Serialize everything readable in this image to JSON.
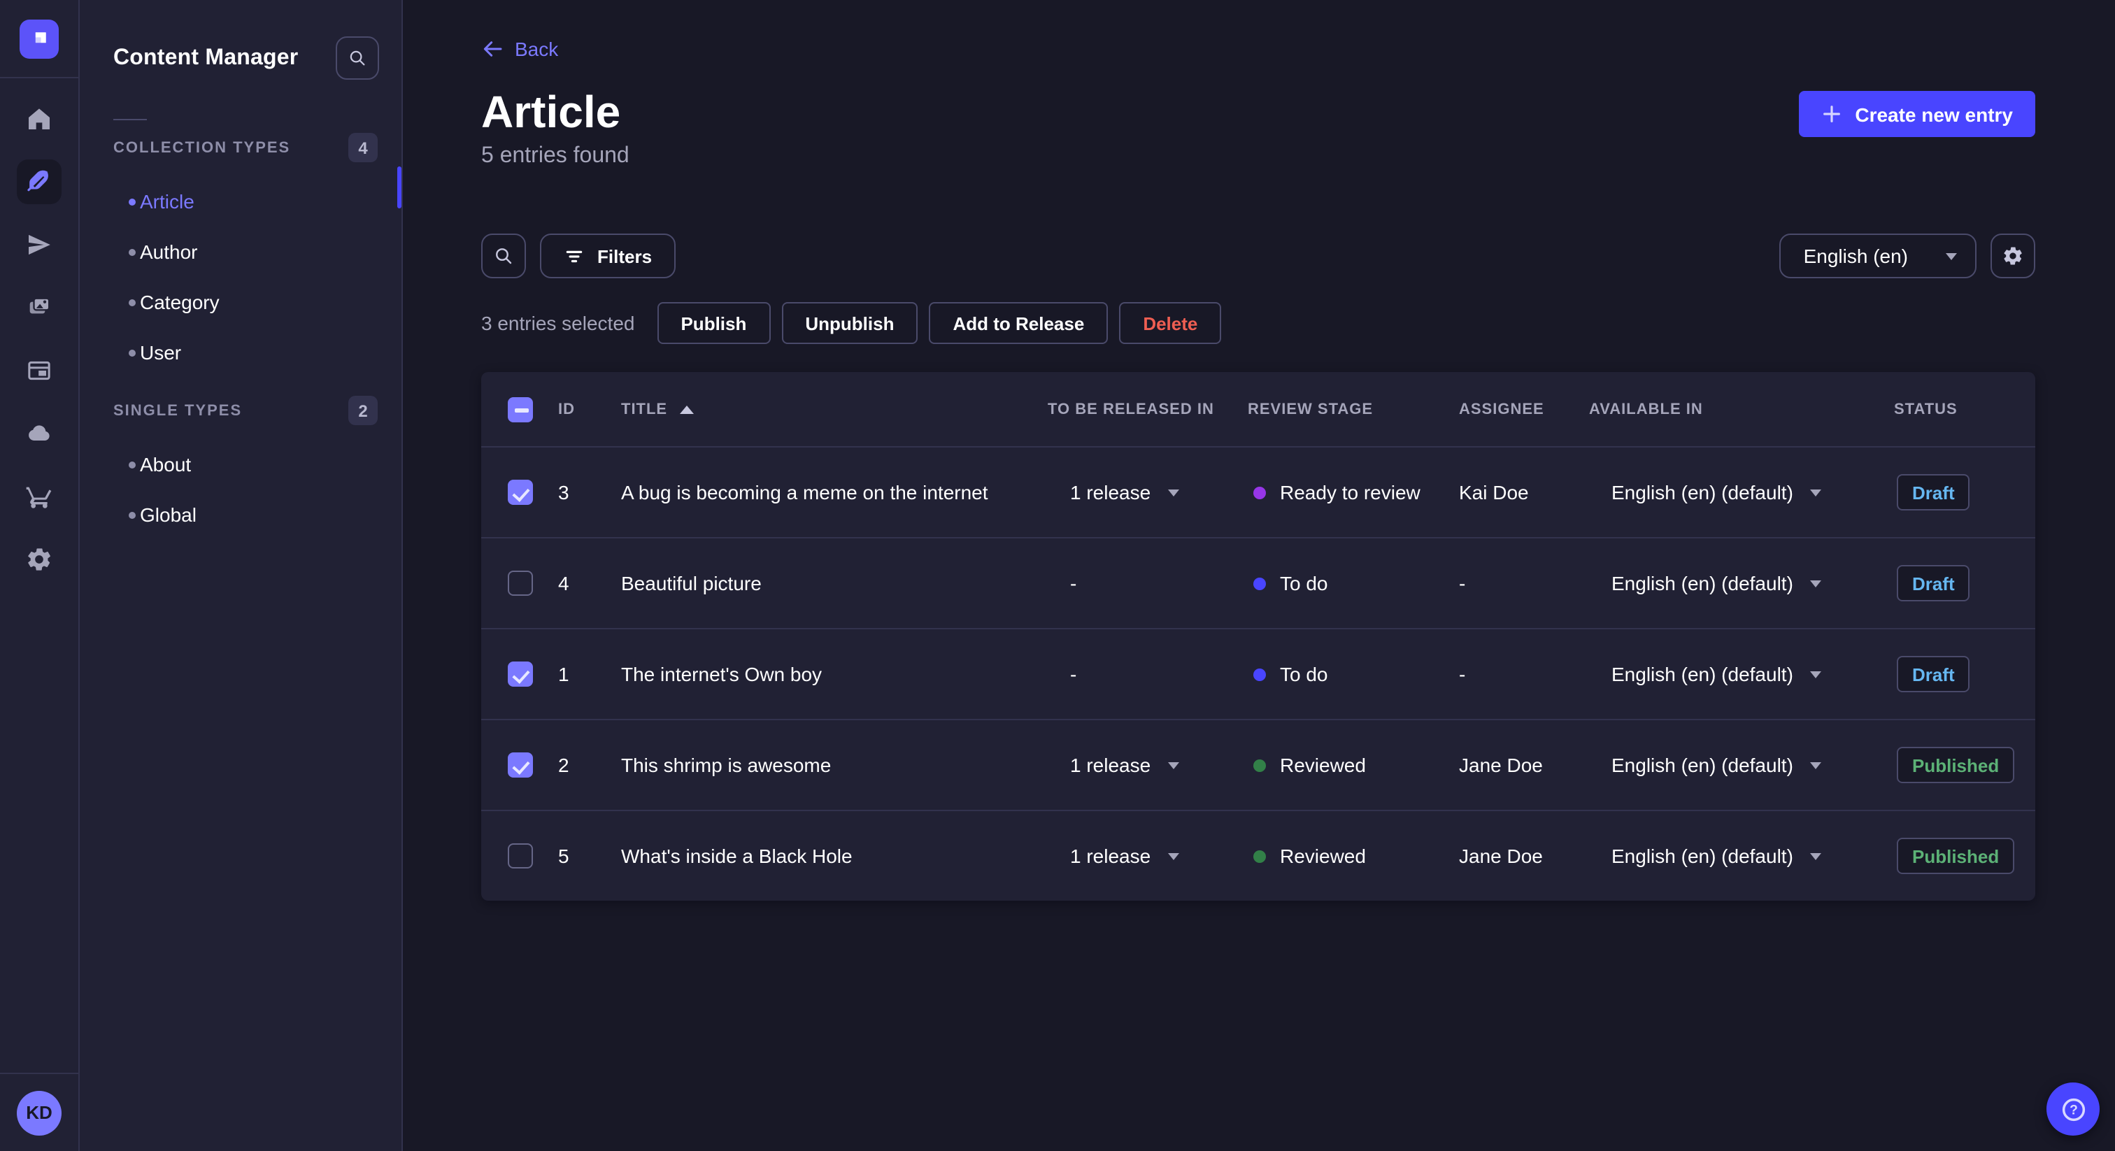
{
  "rail": {
    "items": [
      {
        "icon": "home"
      },
      {
        "icon": "content-manager-feather",
        "active": true
      },
      {
        "icon": "releases-paper-plane"
      },
      {
        "icon": "media-library-images"
      },
      {
        "icon": "content-type-builder-layout"
      },
      {
        "icon": "deploy-cloud"
      },
      {
        "icon": "marketplace-cart"
      },
      {
        "icon": "settings-gear"
      }
    ],
    "avatar_initials": "KD"
  },
  "subnav": {
    "title": "Content Manager",
    "search_icon": "magnifier",
    "sections": [
      {
        "label": "COLLECTION TYPES",
        "badge": "4",
        "items": [
          {
            "label": "Article",
            "active": true
          },
          {
            "label": "Author",
            "active": false
          },
          {
            "label": "Category",
            "active": false
          },
          {
            "label": "User",
            "active": false
          }
        ]
      },
      {
        "label": "SINGLE TYPES",
        "badge": "2",
        "items": [
          {
            "label": "About",
            "active": false
          },
          {
            "label": "Global",
            "active": false
          }
        ]
      }
    ]
  },
  "header": {
    "back_label": "Back",
    "title": "Article",
    "subtitle": "5 entries found",
    "create_button": "Create new entry"
  },
  "toolbar": {
    "filters_label": "Filters",
    "locale_value": "English (en)",
    "icons": [
      "magnifier",
      "filter-bars",
      "chevron-down",
      "gear"
    ]
  },
  "actions": {
    "selected_text": "3 entries selected",
    "publish": "Publish",
    "unpublish": "Unpublish",
    "add_to_release": "Add to Release",
    "delete": "Delete"
  },
  "table": {
    "select_all": "indeterminate",
    "columns": [
      "ID",
      "TITLE",
      "TO BE RELEASED IN",
      "REVIEW STAGE",
      "ASSIGNEE",
      "AVAILABLE IN",
      "STATUS"
    ],
    "sort": {
      "column": "TITLE",
      "direction": "asc"
    },
    "rows": [
      {
        "selected": true,
        "id": "3",
        "title": "A bug is becoming a meme on the internet",
        "released_in": "1 release",
        "has_release": true,
        "stage": "Ready to review",
        "stage_key": "ready",
        "assignee": "Kai Doe",
        "locale": "English (en) (default)",
        "status": "Draft",
        "status_key": "draft"
      },
      {
        "selected": false,
        "id": "4",
        "title": "Beautiful picture",
        "released_in": "-",
        "has_release": false,
        "stage": "To do",
        "stage_key": "todo",
        "assignee": "-",
        "locale": "English (en) (default)",
        "status": "Draft",
        "status_key": "draft"
      },
      {
        "selected": true,
        "id": "1",
        "title": "The internet's Own boy",
        "released_in": "-",
        "has_release": false,
        "stage": "To do",
        "stage_key": "todo",
        "assignee": "-",
        "locale": "English (en) (default)",
        "status": "Draft",
        "status_key": "draft"
      },
      {
        "selected": true,
        "id": "2",
        "title": "This shrimp is awesome",
        "released_in": "1 release",
        "has_release": true,
        "stage": "Reviewed",
        "stage_key": "reviewed",
        "assignee": "Jane Doe",
        "locale": "English (en) (default)",
        "status": "Published",
        "status_key": "published"
      },
      {
        "selected": false,
        "id": "5",
        "title": "What's inside a Black Hole",
        "released_in": "1 release",
        "has_release": true,
        "stage": "Reviewed",
        "stage_key": "reviewed",
        "assignee": "Jane Doe",
        "locale": "English (en) (default)",
        "status": "Published",
        "status_key": "published"
      }
    ]
  },
  "help": {
    "icon": "question-mark-circle"
  },
  "colors": {
    "app_background": "#181826",
    "panel_background": "#212134",
    "border": "#32324d",
    "border_light": "#4a4a6a",
    "accent": "#4945ff",
    "accent_light": "#7b79ff",
    "text_muted": "#a5a5ba",
    "status_draft": "#66b7f1",
    "status_published": "#5cb176",
    "danger": "#ee5e52",
    "stage_ready_to_review": "#9736e8",
    "stage_to_do": "#4945ff",
    "stage_reviewed": "#328048"
  }
}
